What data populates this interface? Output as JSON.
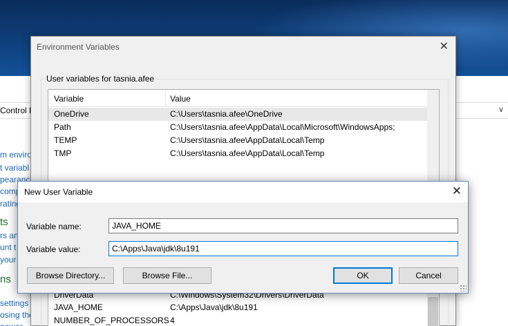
{
  "control_panel": {
    "address_text": "Control F",
    "links": [
      "m enviro",
      "t variabl",
      "pearanc",
      "compu",
      "rating"
    ],
    "heading_1": "ts",
    "links_2": [
      "rs an",
      "unt t",
      "your"
    ],
    "heading_2": "ns",
    "links_3": [
      "settings",
      "osing the",
      "nower"
    ]
  },
  "env_dialog": {
    "title": "Environment Variables",
    "user_group_label": "User variables for tasnia.afee",
    "columns": [
      "Variable",
      "Value"
    ],
    "user_vars": [
      {
        "name": "OneDrive",
        "value": "C:\\Users\\tasnia.afee\\OneDrive"
      },
      {
        "name": "Path",
        "value": "C:\\Users\\tasnia.afee\\AppData\\Local\\Microsoft\\WindowsApps;"
      },
      {
        "name": "TEMP",
        "value": "C:\\Users\\tasnia.afee\\AppData\\Local\\Temp"
      },
      {
        "name": "TMP",
        "value": "C:\\Users\\tasnia.afee\\AppData\\Local\\Temp"
      }
    ],
    "system_vars": [
      {
        "name": "DriverData",
        "value": "C:\\Windows\\System32\\Drivers\\DriverData"
      },
      {
        "name": "JAVA_HOME",
        "value": "C:\\Apps\\Java\\jdk\\8u191"
      },
      {
        "name": "NUMBER_OF_PROCESSORS",
        "value": "4"
      }
    ]
  },
  "new_var_dialog": {
    "title": "New User Variable",
    "name_label": "Variable name:",
    "name_value": "JAVA_HOME",
    "value_label": "Variable value:",
    "value_value": "C:\\Apps\\Java\\jdk\\8u191",
    "browse_directory_label": "Browse Directory...",
    "browse_file_label": "Browse File...",
    "ok_label": "OK",
    "cancel_label": "Cancel"
  }
}
